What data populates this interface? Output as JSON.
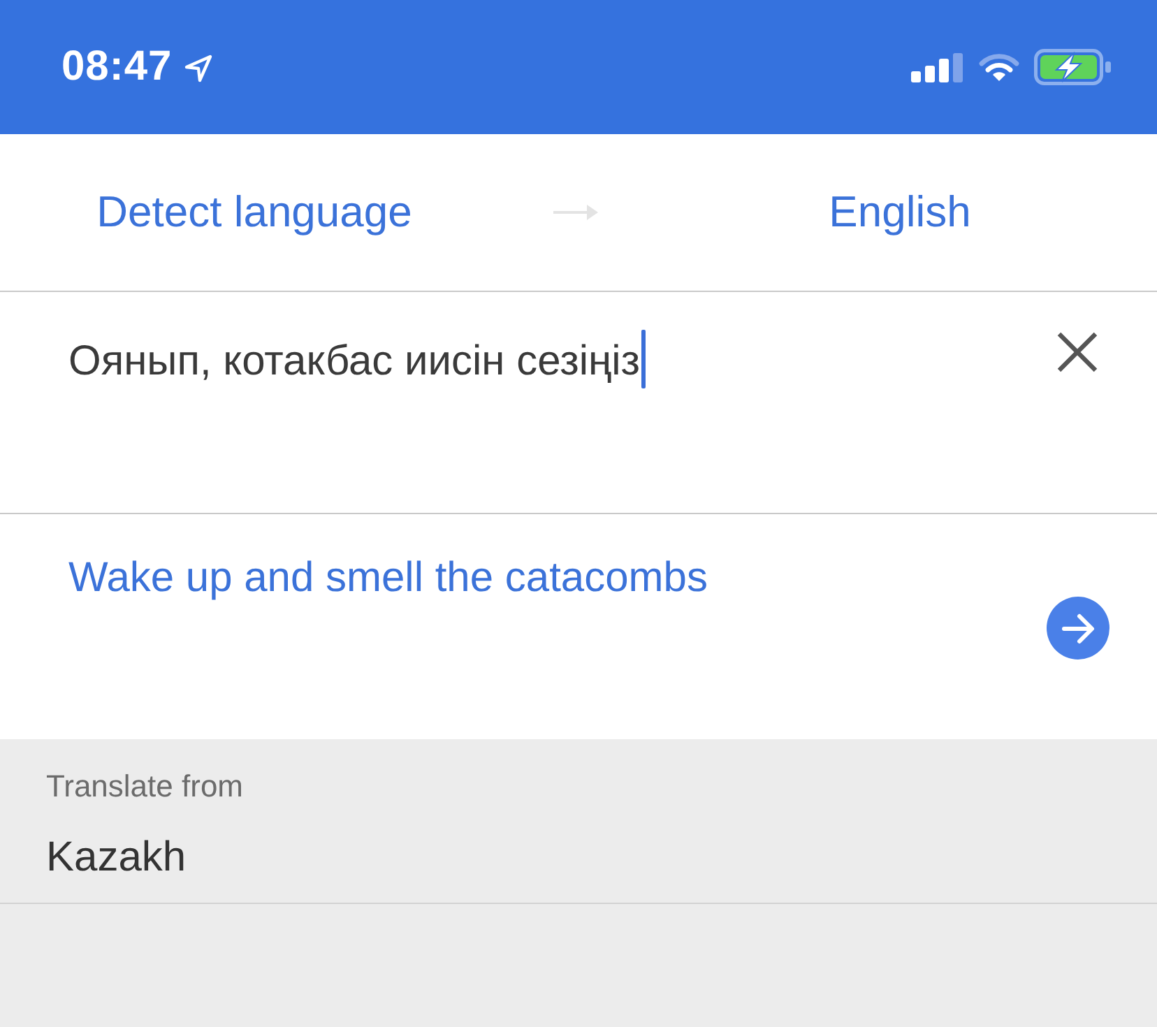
{
  "status_bar": {
    "time": "08:47"
  },
  "language_bar": {
    "source_language": "Detect language",
    "target_language": "English"
  },
  "input": {
    "value": "Оянып, котакбас иисін сезіңіз",
    "focused": true
  },
  "translation": {
    "text": "Wake up and smell the catacombs"
  },
  "suggestions": {
    "heading": "Translate from",
    "items": [
      {
        "label": "Kazakh"
      }
    ]
  }
}
